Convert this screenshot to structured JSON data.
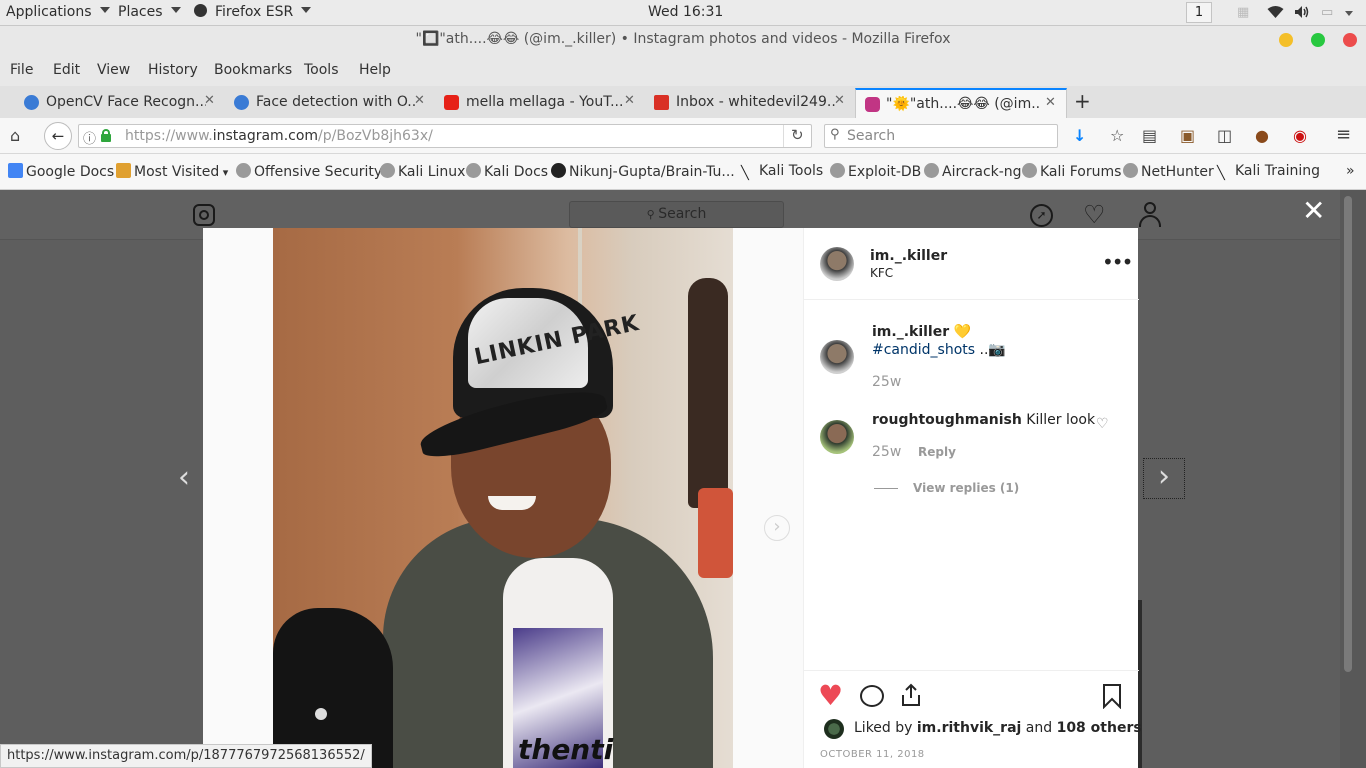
{
  "system_bar": {
    "applications": "Applications",
    "places": "Places",
    "firefox_esr": "Firefox ESR",
    "clock": "Wed 16:31",
    "workspace": "1"
  },
  "window": {
    "title": "\"🔲\"ath....😂😂 (@im._.killer) • Instagram photos and videos - Mozilla Firefox"
  },
  "menu": [
    "File",
    "Edit",
    "View",
    "History",
    "Bookmarks",
    "Tools",
    "Help"
  ],
  "tabs": [
    {
      "label": "OpenCV Face Recogn...",
      "icon_color": "#3a7bd5"
    },
    {
      "label": "Face detection with O...",
      "icon_color": "#3a7bd5"
    },
    {
      "label": "mella mellaga - YouT...",
      "icon_color": "#e62117"
    },
    {
      "label": "Inbox - whitedevil249...",
      "icon_color": "#d93025"
    },
    {
      "label": "\"🌞\"ath....😂😂 (@im....",
      "icon_color": "#c13584",
      "active": true
    }
  ],
  "nav": {
    "url_prefix": "https://www.",
    "url_domain": "instagram.com",
    "url_path": "/p/BozVb8jh63x/",
    "search_placeholder": "Search"
  },
  "bookmarks": [
    "Google Docs",
    "Most Visited",
    "Offensive Security",
    "Kali Linux",
    "Kali Docs",
    "Nikunj-Gupta/Brain-Tu...",
    "Kali Tools",
    "Exploit-DB",
    "Aircrack-ng",
    "Kali Forums",
    "NetHunter",
    "Kali Training"
  ],
  "instagram": {
    "search_placeholder": "Search",
    "post": {
      "username": "im._.killer",
      "location": "KFC",
      "caption_user": "im._.killer",
      "caption_emoji": "💛",
      "hashtag": "#candid_shots",
      "caption_suffix": "..📷",
      "caption_age": "25w",
      "comment": {
        "user": "roughtoughmanish",
        "text": "Killer look",
        "age": "25w",
        "reply": "Reply"
      },
      "view_replies": "View replies (1)",
      "liked_by_prefix": "Liked by",
      "liked_by_user": "im.rithvik_raj",
      "liked_by_and": "and",
      "liked_by_others": "108 others",
      "date": "OCTOBER 11, 2018",
      "hat_text": "LINKIN PARK"
    }
  },
  "status": {
    "url": "https://www.instagram.com/p/1877767972568136552/"
  }
}
